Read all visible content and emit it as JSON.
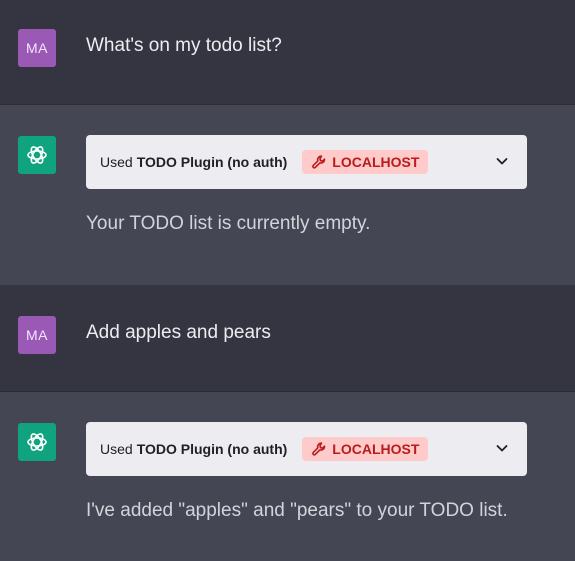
{
  "conversation": {
    "user_1": {
      "avatar": "MA",
      "text": "What's on my todo list?"
    },
    "assistant_1": {
      "plugin": {
        "used_label": "Used",
        "name": "TODO Plugin (no auth)",
        "badge": "LOCALHOST",
        "badge_icon": "wrench-icon"
      },
      "text": "Your TODO list is currently empty."
    },
    "user_2": {
      "avatar": "MA",
      "text": "Add apples and pears"
    },
    "assistant_2": {
      "plugin": {
        "used_label": "Used",
        "name": "TODO Plugin (no auth)",
        "badge": "LOCALHOST",
        "badge_icon": "wrench-icon"
      },
      "text": "I've added \"apples\" and \"pears\" to your TODO list."
    }
  },
  "colors": {
    "user_bg": "#343541",
    "assistant_bg": "#444654",
    "user_avatar": "#9b59b6",
    "assistant_avatar": "#10a37f",
    "badge_bg": "#fecaca",
    "badge_text": "#b91c1c"
  }
}
